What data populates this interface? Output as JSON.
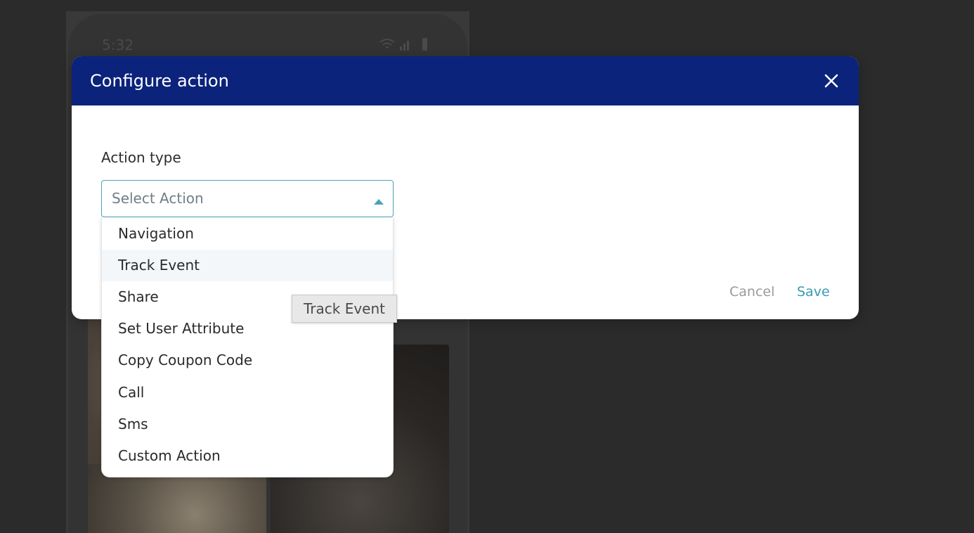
{
  "phone": {
    "time": "5:32",
    "status_icons": "wifi signal battery"
  },
  "modal": {
    "title": "Configure action",
    "field_label": "Action type",
    "cancel_label": "Cancel",
    "save_label": "Save"
  },
  "select": {
    "placeholder": "Select Action",
    "options": [
      {
        "label": "Navigation"
      },
      {
        "label": "Track Event"
      },
      {
        "label": "Share"
      },
      {
        "label": "Set User Attribute"
      },
      {
        "label": "Copy Coupon Code"
      },
      {
        "label": "Call"
      },
      {
        "label": "Sms"
      },
      {
        "label": "Custom Action"
      }
    ],
    "hovered_option": "Track Event"
  },
  "tooltip": {
    "text": "Track Event"
  },
  "colors": {
    "header_bg": "#0b237b",
    "accent": "#3a9bb0",
    "backdrop": "#2b2b2b"
  }
}
